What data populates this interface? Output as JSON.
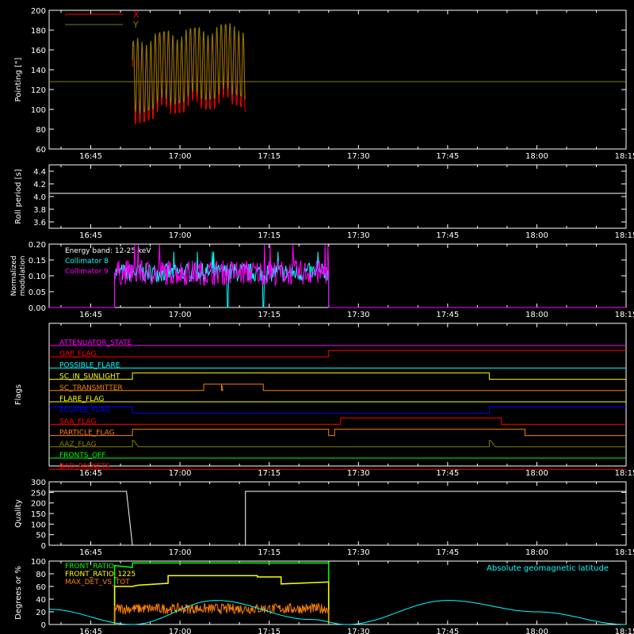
{
  "x_ticks": [
    "16:45",
    "17:00",
    "17:15",
    "17:30",
    "17:45",
    "18:00",
    "18:15"
  ],
  "chart_data": [
    {
      "id": "pointing",
      "type": "line",
      "ylabel": "Pointing [\"]",
      "ylim": [
        60,
        200
      ],
      "yticks": [
        60,
        80,
        100,
        120,
        140,
        160,
        180,
        200
      ],
      "legend": "top-left",
      "series": [
        {
          "name": "X",
          "color": "#ff0000",
          "x": [
            "16:52",
            "16:53",
            "16:55",
            "16:58",
            "17:01",
            "17:04",
            "17:07",
            "17:10",
            "17:11"
          ],
          "y_min": [
            67,
            85,
            90,
            95,
            98,
            100,
            102,
            105,
            97
          ],
          "y_max": [
            165,
            170,
            175,
            178,
            180,
            182,
            184,
            186,
            180
          ]
        },
        {
          "name": "Y",
          "color": "#808000",
          "x": [
            "16:52",
            "16:53",
            "16:55",
            "16:58",
            "17:01",
            "17:04",
            "17:07",
            "17:10",
            "17:11"
          ],
          "y_min": [
            85,
            95,
            100,
            104,
            108,
            110,
            112,
            115,
            110
          ],
          "y_max": [
            168,
            172,
            176,
            179,
            181,
            183,
            185,
            188,
            184
          ]
        },
        {
          "name": "",
          "color": "#808000",
          "x": [
            "16:38",
            "18:15"
          ],
          "y": [
            128,
            128
          ]
        }
      ]
    },
    {
      "id": "roll",
      "type": "line",
      "ylabel": "Roll period [s]",
      "ylim": [
        3.5,
        4.5
      ],
      "yticks": [
        "3.6",
        "3.8",
        "4.0",
        "4.2",
        "4.4"
      ],
      "series": [
        {
          "name": "",
          "color": "#ffffff",
          "x": [
            "16:38",
            "18:15"
          ],
          "y": [
            4.05,
            4.05
          ]
        }
      ]
    },
    {
      "id": "modulation",
      "type": "line",
      "ylabel": "Normalized modulation",
      "ylim": [
        0,
        0.2
      ],
      "yticks": [
        "0.00",
        "0.05",
        "0.10",
        "0.15",
        "0.20"
      ],
      "annotation": "Energy band: 12-25 keV",
      "series": [
        {
          "name": "Collimator 8",
          "color": "#00ffff",
          "x_start": "16:49",
          "x_end": "17:25",
          "level": 0.11,
          "spread": 0.03,
          "dropouts": [
            "17:08",
            "17:14"
          ]
        },
        {
          "name": "Collimator 9",
          "color": "#ff00ff",
          "x_start": "16:49",
          "x_end": "17:25",
          "level": 0.11,
          "spread": 0.04
        }
      ]
    },
    {
      "id": "flags",
      "type": "line",
      "ylabel": "Flags",
      "series": [
        {
          "name": "ATTENUATOR_STATE",
          "color": "#ff00ff",
          "segments": [
            [
              "16:38",
              "18:15",
              0
            ]
          ]
        },
        {
          "name": "GAP_FLAG",
          "color": "#ff0000",
          "segments": [
            [
              "16:38",
              "17:25",
              0
            ],
            [
              "17:25",
              "18:15",
              1
            ]
          ]
        },
        {
          "name": "POSSIBLE_FLARE",
          "color": "#00ffff",
          "segments": [
            [
              "16:38",
              "18:15",
              0
            ]
          ]
        },
        {
          "name": "SC_IN_SUNLIGHT",
          "color": "#ffff00",
          "segments": [
            [
              "16:38",
              "16:52",
              0
            ],
            [
              "16:52",
              "17:52",
              1
            ],
            [
              "17:52",
              "18:15",
              0
            ]
          ]
        },
        {
          "name": "SC_TRANSMITTER",
          "color": "#ff8000",
          "segments": [
            [
              "16:38",
              "17:04",
              0
            ],
            [
              "17:04",
              "17:07",
              1
            ],
            [
              "17:07",
              "17:07",
              0
            ],
            [
              "17:07",
              "17:14",
              1
            ],
            [
              "17:14",
              "18:15",
              0
            ]
          ]
        },
        {
          "name": "FLARE_FLAG",
          "color": "#ffff00",
          "segments": [
            [
              "16:38",
              "18:15",
              0
            ]
          ]
        },
        {
          "name": "ECLIPSE_FLAG",
          "color": "#0000ff",
          "segments": [
            [
              "16:38",
              "16:52",
              1
            ],
            [
              "16:52",
              "17:52",
              0
            ],
            [
              "17:52",
              "18:15",
              1
            ]
          ]
        },
        {
          "name": "SAA_FLAG",
          "color": "#ff0000",
          "segments": [
            [
              "16:38",
              "17:27",
              0
            ],
            [
              "17:27",
              "17:54",
              1
            ],
            [
              "17:54",
              "18:15",
              0
            ]
          ]
        },
        {
          "name": "PARTICLE_FLAG",
          "color": "#ff8000",
          "segments": [
            [
              "16:38",
              "16:52",
              0
            ],
            [
              "16:52",
              "17:25",
              1
            ],
            [
              "17:25",
              "17:26",
              0
            ],
            [
              "17:26",
              "17:58",
              1
            ],
            [
              "17:58",
              "18:15",
              0
            ]
          ]
        },
        {
          "name": "AAZ_FLAG",
          "color": "#808000",
          "segments": [
            [
              "16:38",
              "16:52",
              0
            ],
            [
              "16:52",
              "16:52",
              1
            ],
            [
              "16:53",
              "17:52",
              0
            ],
            [
              "17:52",
              "17:52",
              1
            ],
            [
              "17:53",
              "18:15",
              0
            ]
          ]
        },
        {
          "name": "FRONTS_OFF",
          "color": "#00ff00",
          "segments": [
            [
              "16:38",
              "18:15",
              0
            ]
          ]
        },
        {
          "name": "BAD_PACKETS",
          "color": "#ff0000",
          "segments": [
            [
              "16:38",
              "18:15",
              0
            ]
          ]
        }
      ]
    },
    {
      "id": "quality",
      "type": "line",
      "ylabel": "Quality",
      "ylim": [
        0,
        300
      ],
      "yticks": [
        "0",
        "50",
        "100",
        "150",
        "200",
        "250",
        "300"
      ],
      "series": [
        {
          "name": "",
          "color": "#ffffff",
          "x": [
            "16:38",
            "16:51",
            "16:52",
            "17:11",
            "17:11",
            "18:15"
          ],
          "y": [
            255,
            255,
            0,
            0,
            255,
            255
          ]
        }
      ]
    },
    {
      "id": "geo",
      "type": "line",
      "ylabel": "Degrees or %",
      "ylim": [
        0,
        100
      ],
      "yticks": [
        "0",
        "20",
        "40",
        "60",
        "80",
        "100"
      ],
      "annotation": "Absolute geomagnetic latitude",
      "annotation_color": "#00ffff",
      "series": [
        {
          "name": "FRONT_RATIO",
          "color": "#00ff00",
          "x": [
            "16:49",
            "16:52",
            "16:52",
            "17:25"
          ],
          "y": [
            93,
            90,
            97,
            97
          ]
        },
        {
          "name": "FRONT_RATIO_1225",
          "color": "#ffff00",
          "x": [
            "16:49",
            "16:52",
            "16:53",
            "16:58",
            "16:58",
            "17:13",
            "17:13",
            "17:17",
            "17:17",
            "17:25"
          ],
          "y": [
            60,
            60,
            62,
            65,
            77,
            77,
            75,
            75,
            64,
            67
          ]
        },
        {
          "name": "MAX_DET_VS_TOT",
          "color": "#ff8000",
          "x_start": "16:49",
          "x_end": "17:25",
          "level": 25,
          "spread": 8
        },
        {
          "name": "Absolute geomagnetic latitude",
          "color": "#00ffff",
          "x": [
            "16:38",
            "16:52",
            "17:06",
            "17:22",
            "17:28",
            "17:45",
            "18:00",
            "18:15"
          ],
          "y": [
            24,
            0,
            38,
            8,
            0,
            38,
            20,
            0
          ]
        }
      ]
    }
  ]
}
